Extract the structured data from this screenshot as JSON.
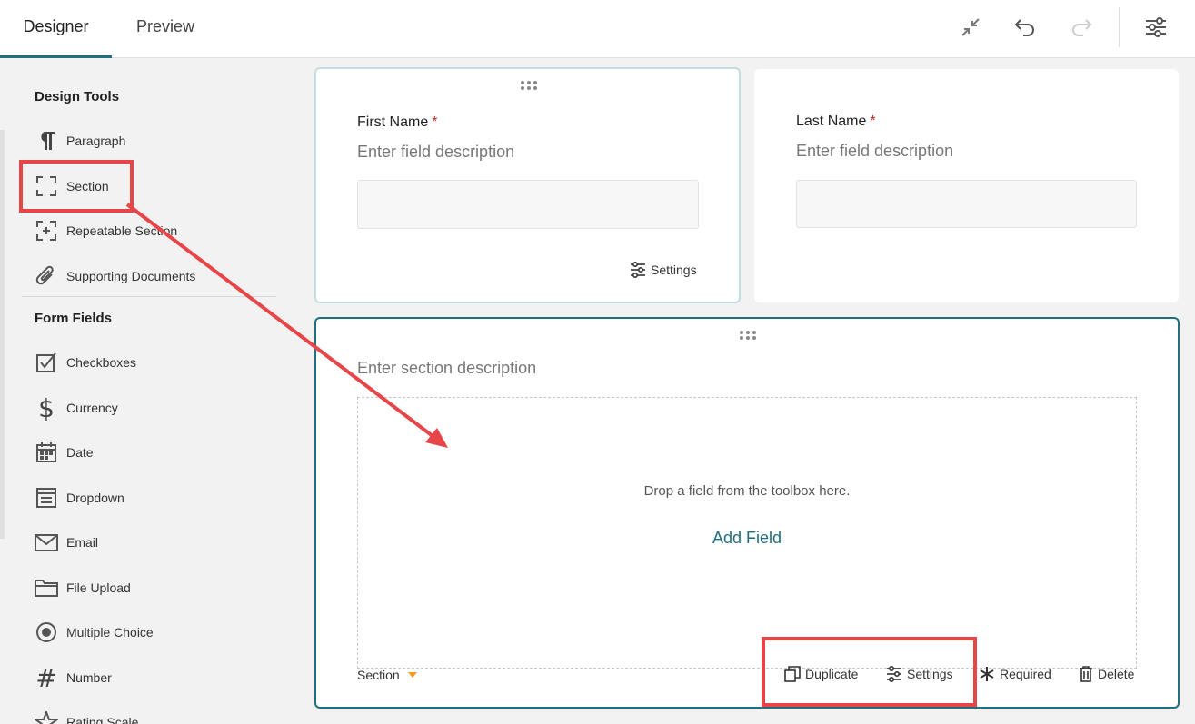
{
  "tabs": {
    "designer": "Designer",
    "preview": "Preview"
  },
  "toolbar_icons": [
    "collapse-icon",
    "undo-icon",
    "redo-icon",
    "form-settings-icon"
  ],
  "sidebar": {
    "design_tools_heading": "Design Tools",
    "design_tools": [
      {
        "label": "Paragraph",
        "icon": "paragraph-icon"
      },
      {
        "label": "Section",
        "icon": "section-icon"
      },
      {
        "label": "Repeatable Section",
        "icon": "repeatable-section-icon"
      },
      {
        "label": "Supporting Documents",
        "icon": "paperclip-icon"
      }
    ],
    "form_fields_heading": "Form Fields",
    "form_fields": [
      {
        "label": "Checkboxes",
        "icon": "checkbox-icon"
      },
      {
        "label": "Currency",
        "icon": "dollar-icon"
      },
      {
        "label": "Date",
        "icon": "calendar-icon"
      },
      {
        "label": "Dropdown",
        "icon": "dropdown-icon"
      },
      {
        "label": "Email",
        "icon": "envelope-icon"
      },
      {
        "label": "File Upload",
        "icon": "folder-icon"
      },
      {
        "label": "Multiple Choice",
        "icon": "radio-icon"
      },
      {
        "label": "Number",
        "icon": "hash-icon"
      },
      {
        "label": "Rating Scale",
        "icon": "star-icon"
      }
    ]
  },
  "fields": {
    "first_name": {
      "label": "First Name",
      "required_mark": "*",
      "description": "Enter field description",
      "settings_label": "Settings"
    },
    "last_name": {
      "label": "Last Name",
      "required_mark": "*",
      "description": "Enter field description"
    }
  },
  "section": {
    "description": "Enter section description",
    "drop_text": "Drop a field from the toolbox here.",
    "add_field": "Add Field",
    "type_label": "Section",
    "actions": {
      "duplicate": "Duplicate",
      "settings": "Settings",
      "required": "Required",
      "delete": "Delete"
    }
  },
  "colors": {
    "accent": "#1e6f80",
    "required": "#c62828",
    "caret": "#f29b1d",
    "annotation": "#e84548"
  }
}
